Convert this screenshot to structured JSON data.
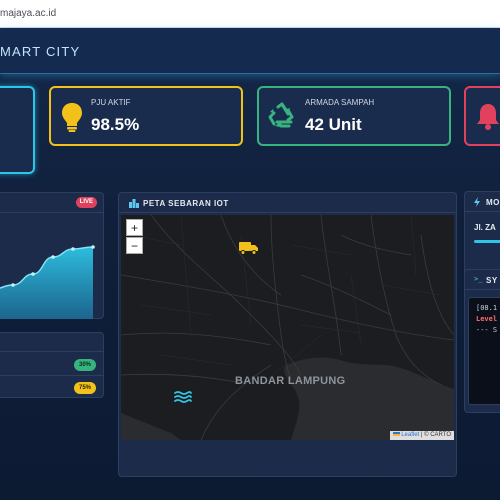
{
  "browser": {
    "url_text": "majaya.ac.id"
  },
  "header": {
    "title": "MART CITY"
  },
  "stats": [
    {
      "label": "PJU AKTIF",
      "value": "98.5%",
      "icon": "lightbulb-icon",
      "color": "#f2c21b"
    },
    {
      "label": "ARMADA SAMPAH",
      "value": "42 Unit",
      "icon": "recycle-icon",
      "color": "#36b37e"
    },
    {
      "label": "",
      "value": "",
      "icon": "bell-icon",
      "color": "#e0425e"
    }
  ],
  "chart_panel": {
    "badge": "LIVE"
  },
  "chart_data": {
    "type": "area",
    "title": "",
    "xlabel": "",
    "ylabel": "",
    "series": [
      {
        "values": [
          30,
          34,
          45,
          62,
          70,
          72
        ]
      }
    ],
    "ylim": [
      0,
      100
    ]
  },
  "level_panel": {
    "items": [
      {
        "value": "30%",
        "color": "#36b37e"
      },
      {
        "value": "75%",
        "color": "#f2c21b"
      }
    ]
  },
  "map_panel": {
    "title": "PETA SEBARAN IOT",
    "zoom_in": "+",
    "zoom_out": "−",
    "city_label": "BANDAR LAMPUNG",
    "attribution_leaflet": "Leaflet",
    "attribution_rest": "| © CARTO"
  },
  "monitor_panel": {
    "title": "MO",
    "street": "Jl. ZA"
  },
  "system_panel": {
    "title": "SY",
    "lines": [
      {
        "text": "[08.1",
        "color": "#c9d1dc"
      },
      {
        "text": "Level",
        "color": "#ff6b6b"
      },
      {
        "text": "--- S",
        "color": "#c9d1dc"
      }
    ]
  }
}
